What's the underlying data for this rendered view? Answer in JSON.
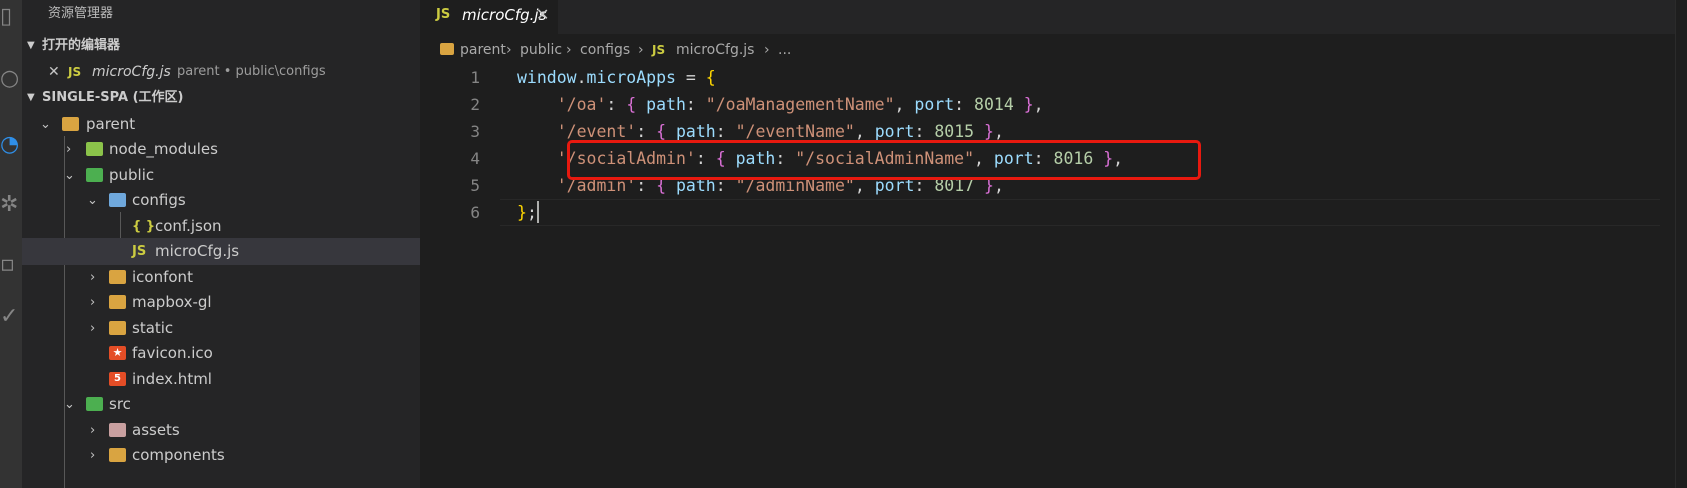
{
  "sidebar": {
    "title": "资源管理器",
    "open_editors": {
      "header": "打开的编辑器",
      "items": [
        {
          "badge": "JS",
          "name": "microCfg.js",
          "path": "parent • public\\configs"
        }
      ]
    },
    "workspace": {
      "header": "SINGLE-SPA (工作区)",
      "tree": [
        {
          "label": "parent",
          "type": "folder",
          "expanded": true
        },
        {
          "label": "node_modules",
          "type": "folder",
          "expanded": false
        },
        {
          "label": "public",
          "type": "folder",
          "expanded": true
        },
        {
          "label": "configs",
          "type": "folder",
          "expanded": true
        },
        {
          "label": "conf.json",
          "type": "file",
          "icon": "{ }"
        },
        {
          "label": "microCfg.js",
          "type": "file",
          "icon": "JS",
          "selected": true
        },
        {
          "label": "iconfont",
          "type": "folder",
          "expanded": false
        },
        {
          "label": "mapbox-gl",
          "type": "folder",
          "expanded": false
        },
        {
          "label": "static",
          "type": "folder",
          "expanded": false
        },
        {
          "label": "favicon.ico",
          "type": "file"
        },
        {
          "label": "index.html",
          "type": "file"
        },
        {
          "label": "src",
          "type": "folder",
          "expanded": true
        },
        {
          "label": "assets",
          "type": "folder",
          "expanded": false
        },
        {
          "label": "components",
          "type": "folder",
          "expanded": false
        }
      ]
    }
  },
  "editor": {
    "tab": {
      "badge": "JS",
      "label": "microCfg.js",
      "close": "✕"
    },
    "breadcrumb": {
      "items": [
        "parent",
        "public",
        "configs",
        "microCfg.js",
        "..."
      ],
      "file_badge": "JS",
      "separator": "›"
    },
    "lines": [
      {
        "number": "1",
        "tokens": [
          {
            "t": "window",
            "c": "c-id"
          },
          {
            "t": ".",
            "c": "c-plain"
          },
          {
            "t": "microApps",
            "c": "c-id"
          },
          {
            "t": " = ",
            "c": "c-plain"
          },
          {
            "t": "{",
            "c": "c-brace1"
          }
        ]
      },
      {
        "number": "2",
        "tokens": [
          {
            "t": "    ",
            "c": "c-plain"
          },
          {
            "t": "'/oa'",
            "c": "c-str"
          },
          {
            "t": ": ",
            "c": "c-plain"
          },
          {
            "t": "{",
            "c": "c-brace2"
          },
          {
            "t": " ",
            "c": "c-plain"
          },
          {
            "t": "path",
            "c": "c-id"
          },
          {
            "t": ": ",
            "c": "c-plain"
          },
          {
            "t": "\"/oaManagementName\"",
            "c": "c-str"
          },
          {
            "t": ", ",
            "c": "c-plain"
          },
          {
            "t": "port",
            "c": "c-id"
          },
          {
            "t": ": ",
            "c": "c-plain"
          },
          {
            "t": "8014",
            "c": "c-num"
          },
          {
            "t": " ",
            "c": "c-plain"
          },
          {
            "t": "}",
            "c": "c-brace2"
          },
          {
            "t": ",",
            "c": "c-plain"
          }
        ]
      },
      {
        "number": "3",
        "tokens": [
          {
            "t": "    ",
            "c": "c-plain"
          },
          {
            "t": "'/event'",
            "c": "c-str"
          },
          {
            "t": ": ",
            "c": "c-plain"
          },
          {
            "t": "{",
            "c": "c-brace2"
          },
          {
            "t": " ",
            "c": "c-plain"
          },
          {
            "t": "path",
            "c": "c-id"
          },
          {
            "t": ": ",
            "c": "c-plain"
          },
          {
            "t": "\"/eventName\"",
            "c": "c-str"
          },
          {
            "t": ", ",
            "c": "c-plain"
          },
          {
            "t": "port",
            "c": "c-id"
          },
          {
            "t": ": ",
            "c": "c-plain"
          },
          {
            "t": "8015",
            "c": "c-num"
          },
          {
            "t": " ",
            "c": "c-plain"
          },
          {
            "t": "}",
            "c": "c-brace2"
          },
          {
            "t": ",",
            "c": "c-plain"
          }
        ]
      },
      {
        "number": "4",
        "tokens": [
          {
            "t": "    ",
            "c": "c-plain"
          },
          {
            "t": "'/socialAdmin'",
            "c": "c-str"
          },
          {
            "t": ": ",
            "c": "c-plain"
          },
          {
            "t": "{",
            "c": "c-brace2"
          },
          {
            "t": " ",
            "c": "c-plain"
          },
          {
            "t": "path",
            "c": "c-id"
          },
          {
            "t": ": ",
            "c": "c-plain"
          },
          {
            "t": "\"/socialAdminName\"",
            "c": "c-str"
          },
          {
            "t": ", ",
            "c": "c-plain"
          },
          {
            "t": "port",
            "c": "c-id"
          },
          {
            "t": ": ",
            "c": "c-plain"
          },
          {
            "t": "8016",
            "c": "c-num"
          },
          {
            "t": " ",
            "c": "c-plain"
          },
          {
            "t": "}",
            "c": "c-brace2"
          },
          {
            "t": ",",
            "c": "c-plain"
          }
        ]
      },
      {
        "number": "5",
        "tokens": [
          {
            "t": "    ",
            "c": "c-plain"
          },
          {
            "t": "'/admin'",
            "c": "c-str"
          },
          {
            "t": ": ",
            "c": "c-plain"
          },
          {
            "t": "{",
            "c": "c-brace2"
          },
          {
            "t": " ",
            "c": "c-plain"
          },
          {
            "t": "path",
            "c": "c-id"
          },
          {
            "t": ": ",
            "c": "c-plain"
          },
          {
            "t": "\"/adminName\"",
            "c": "c-str"
          },
          {
            "t": ", ",
            "c": "c-plain"
          },
          {
            "t": "port",
            "c": "c-id"
          },
          {
            "t": ": ",
            "c": "c-plain"
          },
          {
            "t": "8017",
            "c": "c-num"
          },
          {
            "t": " ",
            "c": "c-plain"
          },
          {
            "t": "}",
            "c": "c-brace2"
          },
          {
            "t": ",",
            "c": "c-plain"
          }
        ]
      },
      {
        "number": "6",
        "tokens": [
          {
            "t": "}",
            "c": "c-brace1"
          },
          {
            "t": ";",
            "c": "c-plain"
          }
        ]
      }
    ]
  },
  "colors": {
    "highlight": "#e8190f",
    "accent": "#2f8fe8",
    "js_badge": "#cbcb41"
  }
}
